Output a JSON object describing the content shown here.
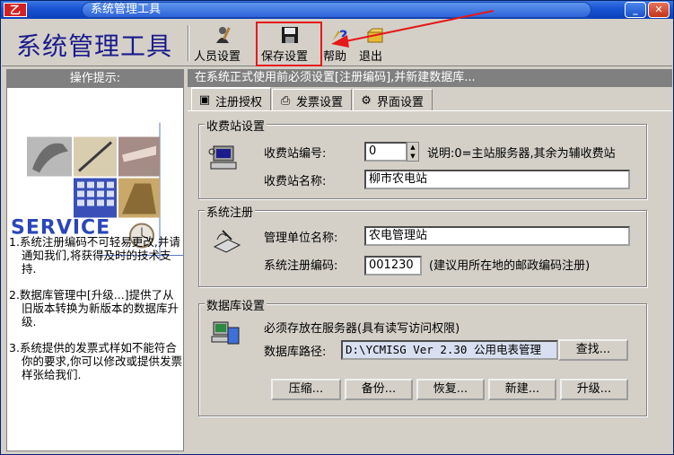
{
  "window": {
    "title": "系统管理工具",
    "app_icon_glyph": "乙"
  },
  "toolbar": {
    "app_name": "系统管理工具",
    "buttons": [
      {
        "label": "人员设置",
        "icon": "people-icon"
      },
      {
        "label": "保存设置",
        "icon": "floppy-save-icon"
      },
      {
        "label": "帮助",
        "icon": "help-icon"
      },
      {
        "label": "退出",
        "icon": "exit-icon"
      }
    ],
    "highlight_color": "#e51919"
  },
  "left": {
    "header": "操作提示:",
    "service_text": "SERVICE",
    "tips": [
      "1.系统注册编码不可轻易更改,并请通知我们,将获得及时的技术支持.",
      "2.数据库管理中[升级...]提供了从旧版本转换为新版本的数据库升级.",
      "3.系统提供的发票式样如不能符合你的要求,你可以修改或提供发票样张给我们."
    ]
  },
  "right": {
    "hint": "在系统正式使用前必须设置[注册编码],并新建数据库...",
    "tabs": [
      {
        "label": "注册授权",
        "icon": "register-icon"
      },
      {
        "label": "发票设置",
        "icon": "printer-icon"
      },
      {
        "label": "界面设置",
        "icon": "settings-icon"
      }
    ],
    "station": {
      "title": "收费站设置",
      "id_label": "收费站编号:",
      "id_value": "0",
      "note": "说明:0=主站服务器,其余为辅收费站",
      "name_label": "收费站名称:",
      "name_value": "柳市农电站"
    },
    "register": {
      "title": "系统注册",
      "unit_label": "管理单位名称:",
      "unit_value": "农电管理站",
      "code_label": "系统注册编码:",
      "code_value": "001230",
      "code_note": "(建议用所在地的邮政编码注册)"
    },
    "database": {
      "title": "数据库设置",
      "note": "必须存放在服务器(具有读写访问权限)",
      "path_label": "数据库路径:",
      "path_value": "D:\\YCMISG Ver 2.30 公用电表管理",
      "browse_label": "查找...",
      "buttons": [
        "压缩...",
        "备份...",
        "恢复...",
        "新建...",
        "升级..."
      ]
    }
  }
}
